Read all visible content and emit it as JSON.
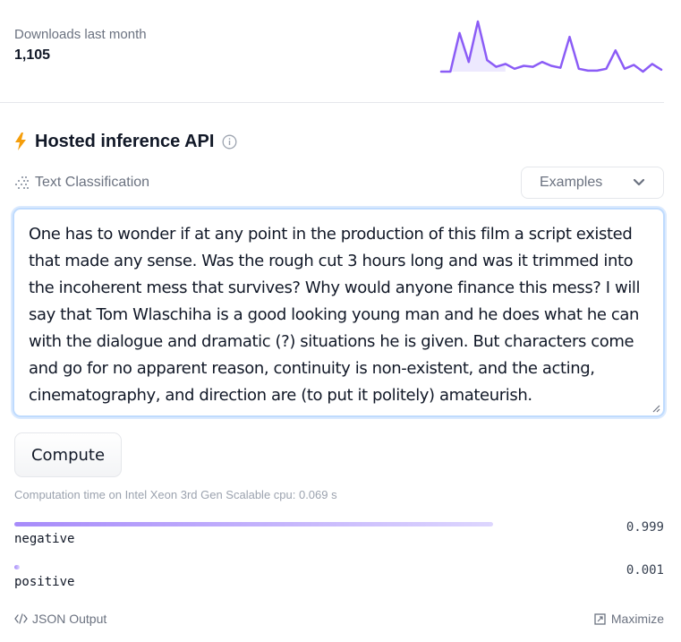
{
  "downloads": {
    "label": "Downloads last month",
    "count": "1,105",
    "sparkline_values": [
      0,
      0,
      40,
      10,
      52,
      12,
      5,
      8,
      3,
      6,
      5,
      10,
      6,
      4,
      36,
      3,
      1,
      1,
      3,
      22,
      3,
      7,
      0,
      8,
      2
    ]
  },
  "api": {
    "title": "Hosted inference API",
    "bolt_icon": "lightning-bolt-icon",
    "info_icon": "info-icon"
  },
  "task": {
    "icon": "text-classification-icon",
    "label": "Text Classification"
  },
  "examples": {
    "label": "Examples",
    "icon": "chevron-down-icon"
  },
  "input": {
    "text": "One has to wonder if at any point in the production of this film a script existed that made any sense. Was the rough cut 3 hours long and was it trimmed into the incoherent mess that survives? Why would anyone finance this mess? I will say that Tom Wlaschiha is a good looking young man and he does what he can with the dialogue and dramatic (?) situations he is given. But characters come and go for no apparent reason, continuity is non-existent, and the acting, cinematography, and direction are (to put it politely) amateurish."
  },
  "compute": {
    "label": "Compute"
  },
  "computation_time": "Computation time on Intel Xeon 3rd Gen Scalable cpu: 0.069 s",
  "results": [
    {
      "label": "negative",
      "score": "0.999",
      "fraction": 0.999
    },
    {
      "label": "positive",
      "score": "0.001",
      "fraction": 0.001
    }
  ],
  "footer": {
    "json_output": "JSON Output",
    "maximize": "Maximize"
  },
  "colors": {
    "accent": "#8b5cf6",
    "bolt": "#f59e0b"
  }
}
